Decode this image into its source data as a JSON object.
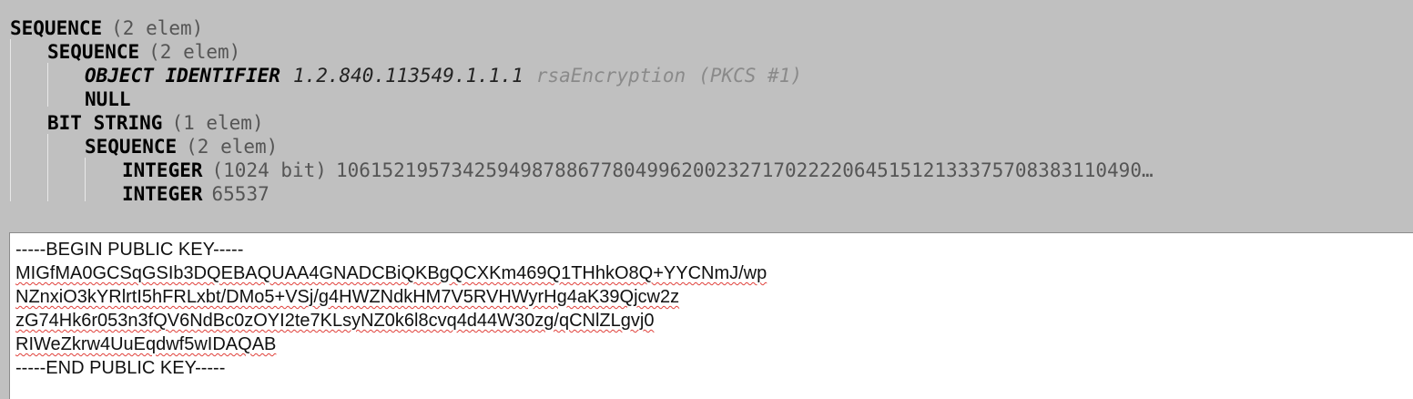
{
  "asn1_tree": {
    "row1": {
      "tag": "SEQUENCE",
      "meta": "(2 elem)"
    },
    "row2": {
      "tag": "SEQUENCE",
      "meta": "(2 elem)"
    },
    "row3": {
      "tag": "OBJECT IDENTIFIER",
      "value": "1.2.840.113549.1.1.1",
      "name": "rsaEncryption",
      "ref": "(PKCS #1)"
    },
    "row4": {
      "tag": "NULL"
    },
    "row5": {
      "tag": "BIT STRING",
      "meta": "(1 elem)"
    },
    "row6": {
      "tag": "SEQUENCE",
      "meta": "(2 elem)"
    },
    "row7": {
      "tag": "INTEGER",
      "meta": "(1024 bit)",
      "value": "1061521957342594987886778049962002327170222206451512133375708383110490…"
    },
    "row8": {
      "tag": "INTEGER",
      "value": "65537"
    }
  },
  "pem_editor": {
    "lines": [
      "-----BEGIN PUBLIC KEY-----",
      "MIGfMA0GCSqGSIb3DQEBAQUAA4GNADCBiQKBgQCXKm469Q1THhkO8Q+YYCNmJ/wp",
      "NZnxiO3kYRlrtI5hFRLxbt/DMo5+VSj/g4HWZNdkHM7V5RVHWyrHg4aK39Qjcw2z",
      "zG74Hk6r053n3fQV6NdBc0zOYI2te7KLsyNZ0k6l8cvq4d44W30zg/qCNlZLgvj0",
      "RIWeZkrw4UuEqdwf5wIDAQAB",
      "-----END PUBLIC KEY-----"
    ]
  },
  "colors": {
    "tree_background": "#c0c0c0",
    "editor_background": "#ffffff",
    "spellcheck_underline": "#e0403a"
  }
}
